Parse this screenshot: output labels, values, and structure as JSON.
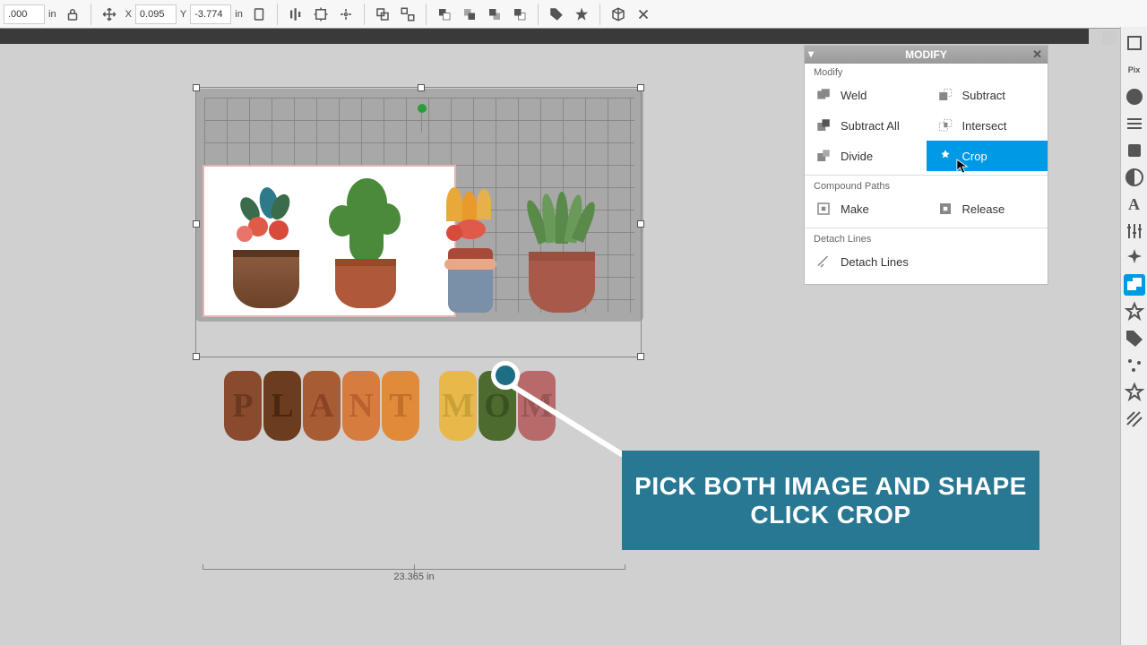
{
  "toolbar": {
    "dim_left": ".000",
    "unit1": "in",
    "x_label": "X",
    "x_val": "0.095",
    "y_label": "Y",
    "y_val": "-3.774",
    "unit2": "in"
  },
  "canvas": {
    "ruler_bottom": "23.365 in"
  },
  "modify": {
    "title": "MODIFY",
    "section1": "Modify",
    "weld": "Weld",
    "subtract": "Subtract",
    "subtract_all": "Subtract All",
    "intersect": "Intersect",
    "divide": "Divide",
    "crop": "Crop",
    "section2": "Compound Paths",
    "make": "Make",
    "release": "Release",
    "section3": "Detach Lines",
    "detach": "Detach Lines"
  },
  "callout": {
    "line1": "PICK BOTH IMAGE AND SHAPE",
    "line2": "CLICK CROP"
  },
  "artwork": {
    "text": "PLANT MOM",
    "letter_colors": [
      "#8a4a2e",
      "#6b3d1e",
      "#a85c34",
      "#d67c3e",
      "#e08a3a",
      "#e8b84a",
      "#4d6b2e",
      "#a85c5c",
      "#b86a6a"
    ]
  }
}
